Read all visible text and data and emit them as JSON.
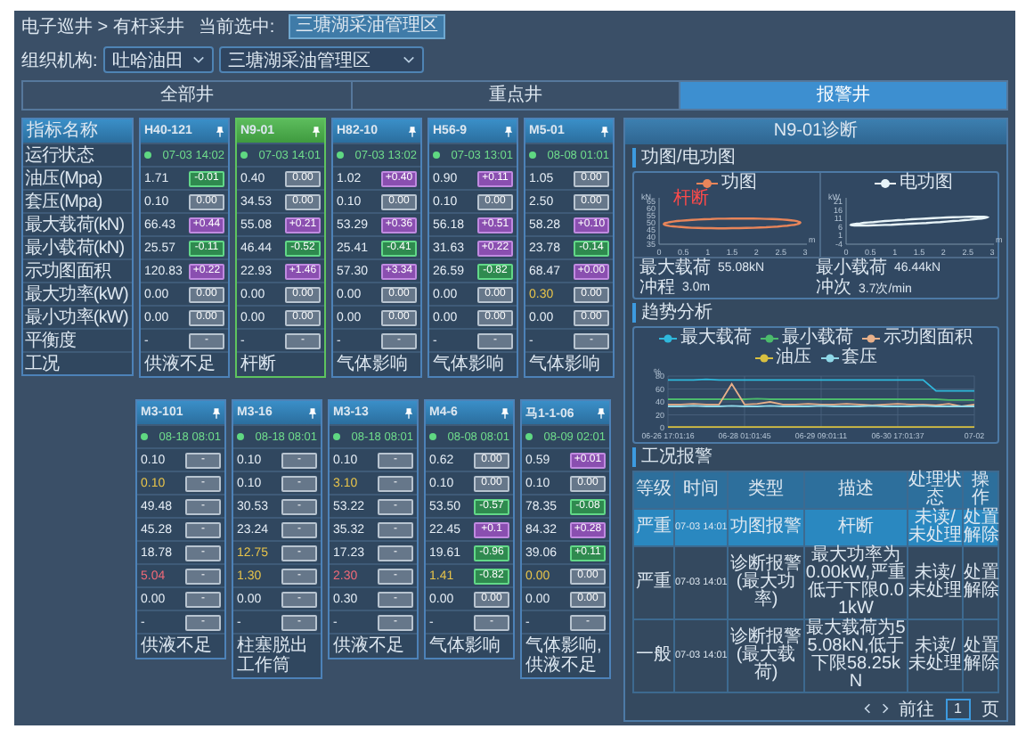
{
  "breadcrumb": {
    "path": "电子巡井 > 有杆采井",
    "current_label": "当前选中:",
    "current_value": "三塘湖采油管理区"
  },
  "filters": {
    "label": "组织机构:",
    "org": "吐哈油田",
    "unit": "三塘湖采油管理区"
  },
  "tabs": [
    {
      "label": "全部井",
      "selected": false
    },
    {
      "label": "重点井",
      "selected": false
    },
    {
      "label": "报警井",
      "selected": true
    }
  ],
  "indicator_header": "指标名称",
  "indicators": [
    "运行状态",
    "油压(Mpa)",
    "套压(Mpa)",
    "最大载荷(kN)",
    "最小载荷(kN)",
    "示功图面积",
    "最大功率(kW)",
    "最小功率(kW)",
    "平衡度",
    "工况"
  ],
  "well_rows": [
    {
      "wells": [
        {
          "name": "H40-121",
          "selected": false,
          "time": "07-03 14:02",
          "values": [
            {
              "value": "1.71",
              "warning": false,
              "alarm": false,
              "delta": "-0.01",
              "up": false,
              "down": true
            },
            {
              "value": "0.10",
              "warning": false,
              "alarm": false,
              "delta": "0.00",
              "up": false,
              "down": false
            },
            {
              "value": "66.43",
              "warning": false,
              "alarm": false,
              "delta": "+0.44",
              "up": true,
              "down": false
            },
            {
              "value": "25.57",
              "warning": false,
              "alarm": false,
              "delta": "-0.11",
              "up": false,
              "down": true
            },
            {
              "value": "120.83",
              "warning": false,
              "alarm": false,
              "delta": "+0.22",
              "up": true,
              "down": false
            },
            {
              "value": "0.00",
              "warning": false,
              "alarm": false,
              "delta": "0.00",
              "up": false,
              "down": false
            },
            {
              "value": "0.00",
              "warning": false,
              "alarm": false,
              "delta": "0.00",
              "up": false,
              "down": false
            },
            {
              "value": "-",
              "warning": false,
              "alarm": false,
              "delta": "-",
              "up": false,
              "down": false
            }
          ],
          "condition": "供液不足"
        },
        {
          "name": "N9-01",
          "selected": true,
          "time": "07-03 14:01",
          "values": [
            {
              "value": "0.40",
              "warning": false,
              "alarm": false,
              "delta": "0.00",
              "up": false,
              "down": false
            },
            {
              "value": "34.53",
              "warning": false,
              "alarm": false,
              "delta": "0.00",
              "up": false,
              "down": false
            },
            {
              "value": "55.08",
              "warning": false,
              "alarm": false,
              "delta": "+0.21",
              "up": true,
              "down": false
            },
            {
              "value": "46.44",
              "warning": false,
              "alarm": false,
              "delta": "-0.52",
              "up": false,
              "down": true
            },
            {
              "value": "22.93",
              "warning": false,
              "alarm": false,
              "delta": "+1.46",
              "up": true,
              "down": false
            },
            {
              "value": "0.00",
              "warning": false,
              "alarm": false,
              "delta": "0.00",
              "up": false,
              "down": false
            },
            {
              "value": "0.00",
              "warning": false,
              "alarm": false,
              "delta": "0.00",
              "up": false,
              "down": false
            },
            {
              "value": "-",
              "warning": false,
              "alarm": false,
              "delta": "-",
              "up": false,
              "down": false
            }
          ],
          "condition": "杆断"
        },
        {
          "name": "H82-10",
          "selected": false,
          "time": "07-03 13:02",
          "values": [
            {
              "value": "1.02",
              "warning": false,
              "alarm": false,
              "delta": "+0.40",
              "up": true,
              "down": false
            },
            {
              "value": "0.10",
              "warning": false,
              "alarm": false,
              "delta": "0.00",
              "up": false,
              "down": false
            },
            {
              "value": "53.29",
              "warning": false,
              "alarm": false,
              "delta": "+0.36",
              "up": true,
              "down": false
            },
            {
              "value": "25.41",
              "warning": false,
              "alarm": false,
              "delta": "-0.41",
              "up": false,
              "down": true
            },
            {
              "value": "57.30",
              "warning": false,
              "alarm": false,
              "delta": "+3.34",
              "up": true,
              "down": false
            },
            {
              "value": "0.00",
              "warning": false,
              "alarm": false,
              "delta": "0.00",
              "up": false,
              "down": false
            },
            {
              "value": "0.00",
              "warning": false,
              "alarm": false,
              "delta": "0.00",
              "up": false,
              "down": false
            },
            {
              "value": "-",
              "warning": false,
              "alarm": false,
              "delta": "-",
              "up": false,
              "down": false
            }
          ],
          "condition": "气体影响"
        },
        {
          "name": "H56-9",
          "selected": false,
          "time": "07-03 13:01",
          "values": [
            {
              "value": "0.90",
              "warning": false,
              "alarm": false,
              "delta": "+0.11",
              "up": true,
              "down": false
            },
            {
              "value": "0.10",
              "warning": false,
              "alarm": false,
              "delta": "0.00",
              "up": false,
              "down": false
            },
            {
              "value": "56.18",
              "warning": false,
              "alarm": false,
              "delta": "+0.51",
              "up": true,
              "down": false
            },
            {
              "value": "31.63",
              "warning": false,
              "alarm": false,
              "delta": "+0.22",
              "up": true,
              "down": false
            },
            {
              "value": "26.59",
              "warning": false,
              "alarm": false,
              "delta": "-0.82",
              "up": false,
              "down": true
            },
            {
              "value": "0.00",
              "warning": false,
              "alarm": false,
              "delta": "0.00",
              "up": false,
              "down": false
            },
            {
              "value": "0.00",
              "warning": false,
              "alarm": false,
              "delta": "0.00",
              "up": false,
              "down": false
            },
            {
              "value": "-",
              "warning": false,
              "alarm": false,
              "delta": "-",
              "up": false,
              "down": false
            }
          ],
          "condition": "气体影响"
        },
        {
          "name": "M5-01",
          "selected": false,
          "time": "08-08 01:01",
          "values": [
            {
              "value": "1.05",
              "warning": false,
              "alarm": false,
              "delta": "0.00",
              "up": false,
              "down": false
            },
            {
              "value": "2.50",
              "warning": false,
              "alarm": false,
              "delta": "0.00",
              "up": false,
              "down": false
            },
            {
              "value": "58.28",
              "warning": false,
              "alarm": false,
              "delta": "+0.10",
              "up": true,
              "down": false
            },
            {
              "value": "23.78",
              "warning": false,
              "alarm": false,
              "delta": "-0.14",
              "up": false,
              "down": true
            },
            {
              "value": "68.47",
              "warning": false,
              "alarm": false,
              "delta": "+0.00",
              "up": true,
              "down": false
            },
            {
              "value": "0.30",
              "warning": true,
              "alarm": false,
              "delta": "0.00",
              "up": false,
              "down": false
            },
            {
              "value": "0.00",
              "warning": false,
              "alarm": false,
              "delta": "0.00",
              "up": false,
              "down": false
            },
            {
              "value": "-",
              "warning": false,
              "alarm": false,
              "delta": "-",
              "up": false,
              "down": false
            }
          ],
          "condition": "气体影响"
        }
      ]
    },
    {
      "wells": [
        {
          "name": "M3-101",
          "selected": false,
          "time": "08-18 08:01",
          "values": [
            {
              "value": "0.10",
              "warning": false,
              "alarm": false,
              "delta": "-",
              "up": false,
              "down": false
            },
            {
              "value": "0.10",
              "warning": true,
              "alarm": false,
              "delta": "-",
              "up": false,
              "down": false
            },
            {
              "value": "49.48",
              "warning": false,
              "alarm": false,
              "delta": "-",
              "up": false,
              "down": false
            },
            {
              "value": "45.28",
              "warning": false,
              "alarm": false,
              "delta": "-",
              "up": false,
              "down": false
            },
            {
              "value": "18.78",
              "warning": false,
              "alarm": false,
              "delta": "-",
              "up": false,
              "down": false
            },
            {
              "value": "5.04",
              "warning": false,
              "alarm": true,
              "delta": "-",
              "up": false,
              "down": false
            },
            {
              "value": "0.00",
              "warning": false,
              "alarm": false,
              "delta": "-",
              "up": false,
              "down": false
            },
            {
              "value": "-",
              "warning": false,
              "alarm": false,
              "delta": "-",
              "up": false,
              "down": false
            }
          ],
          "condition": "供液不足"
        },
        {
          "name": "M3-16",
          "selected": false,
          "time": "08-18 08:01",
          "values": [
            {
              "value": "0.10",
              "warning": false,
              "alarm": false,
              "delta": "-",
              "up": false,
              "down": false
            },
            {
              "value": "0.10",
              "warning": false,
              "alarm": false,
              "delta": "-",
              "up": false,
              "down": false
            },
            {
              "value": "30.53",
              "warning": false,
              "alarm": false,
              "delta": "-",
              "up": false,
              "down": false
            },
            {
              "value": "23.24",
              "warning": false,
              "alarm": false,
              "delta": "-",
              "up": false,
              "down": false
            },
            {
              "value": "12.75",
              "warning": true,
              "alarm": false,
              "delta": "-",
              "up": false,
              "down": false
            },
            {
              "value": "1.30",
              "warning": true,
              "alarm": false,
              "delta": "-",
              "up": false,
              "down": false
            },
            {
              "value": "0.00",
              "warning": false,
              "alarm": false,
              "delta": "-",
              "up": false,
              "down": false
            },
            {
              "value": "-",
              "warning": false,
              "alarm": false,
              "delta": "-",
              "up": false,
              "down": false
            }
          ],
          "condition": "柱塞脱出工作筒"
        },
        {
          "name": "M3-13",
          "selected": false,
          "time": "08-18 08:01",
          "values": [
            {
              "value": "0.10",
              "warning": false,
              "alarm": false,
              "delta": "-",
              "up": false,
              "down": false
            },
            {
              "value": "3.10",
              "warning": true,
              "alarm": false,
              "delta": "-",
              "up": false,
              "down": false
            },
            {
              "value": "53.22",
              "warning": false,
              "alarm": false,
              "delta": "-",
              "up": false,
              "down": false
            },
            {
              "value": "35.32",
              "warning": false,
              "alarm": false,
              "delta": "-",
              "up": false,
              "down": false
            },
            {
              "value": "17.23",
              "warning": false,
              "alarm": false,
              "delta": "-",
              "up": false,
              "down": false
            },
            {
              "value": "2.30",
              "warning": false,
              "alarm": true,
              "delta": "-",
              "up": false,
              "down": false
            },
            {
              "value": "0.30",
              "warning": false,
              "alarm": false,
              "delta": "-",
              "up": false,
              "down": false
            },
            {
              "value": "-",
              "warning": false,
              "alarm": false,
              "delta": "-",
              "up": false,
              "down": false
            }
          ],
          "condition": "供液不足"
        },
        {
          "name": "M4-6",
          "selected": false,
          "time": "08-08 08:01",
          "values": [
            {
              "value": "0.62",
              "warning": false,
              "alarm": false,
              "delta": "0.00",
              "up": false,
              "down": false
            },
            {
              "value": "0.10",
              "warning": false,
              "alarm": false,
              "delta": "0.00",
              "up": false,
              "down": false
            },
            {
              "value": "53.50",
              "warning": false,
              "alarm": false,
              "delta": "-0.57",
              "up": false,
              "down": true
            },
            {
              "value": "22.45",
              "warning": false,
              "alarm": false,
              "delta": "+0.1",
              "up": true,
              "down": false
            },
            {
              "value": "19.61",
              "warning": false,
              "alarm": false,
              "delta": "-0.96",
              "up": false,
              "down": true
            },
            {
              "value": "1.41",
              "warning": true,
              "alarm": false,
              "delta": "-0.82",
              "up": false,
              "down": true
            },
            {
              "value": "0.00",
              "warning": false,
              "alarm": false,
              "delta": "0.00",
              "up": false,
              "down": false
            },
            {
              "value": "-",
              "warning": false,
              "alarm": false,
              "delta": "-",
              "up": false,
              "down": false
            }
          ],
          "condition": "气体影响"
        },
        {
          "name": "马1-1-06",
          "selected": false,
          "time": "08-09 02:01",
          "values": [
            {
              "value": "0.59",
              "warning": false,
              "alarm": false,
              "delta": "+0.01",
              "up": true,
              "down": false
            },
            {
              "value": "0.10",
              "warning": false,
              "alarm": false,
              "delta": "0.00",
              "up": false,
              "down": false
            },
            {
              "value": "78.35",
              "warning": false,
              "alarm": false,
              "delta": "-0.08",
              "up": false,
              "down": true
            },
            {
              "value": "84.32",
              "warning": false,
              "alarm": false,
              "delta": "+0.28",
              "up": true,
              "down": false
            },
            {
              "value": "39.06",
              "warning": false,
              "alarm": false,
              "delta": "+0.11",
              "up": false,
              "down": true
            },
            {
              "value": "0.00",
              "warning": true,
              "alarm": false,
              "delta": "0.00",
              "up": false,
              "down": false
            },
            {
              "value": "0.00",
              "warning": false,
              "alarm": false,
              "delta": "0.00",
              "up": false,
              "down": false
            },
            {
              "value": "-",
              "warning": false,
              "alarm": false,
              "delta": "-",
              "up": false,
              "down": false
            }
          ],
          "condition": "气体影响, 供液不足"
        }
      ]
    }
  ],
  "detail": {
    "title": "N9-01诊断",
    "card_section": {
      "title": "功图/电功图",
      "charts": [
        {
          "kind": "load",
          "legend": "功图",
          "color": "#e8855a",
          "alert": "杆断",
          "y_unit": "kN",
          "y_ticks": [
            "65",
            "60",
            "55",
            "50",
            "45",
            "40",
            "35"
          ],
          "x_unit": "m",
          "x_ticks": [
            "0",
            "0.5",
            "1",
            "1.5",
            "2",
            "2.5",
            "3"
          ]
        },
        {
          "kind": "power",
          "legend": "电功图",
          "color": "#e8f4f8",
          "y_unit": "kW",
          "y_ticks": [
            "21",
            "16",
            "11",
            "6",
            "1",
            "-4"
          ],
          "x_unit": "m",
          "x_ticks": [
            "0",
            "0.5",
            "1",
            "1.5",
            "2",
            "2.5",
            "3"
          ]
        }
      ],
      "stats": [
        {
          "label": "最大载荷",
          "value": "55.08kN"
        },
        {
          "label": "最小载荷",
          "value": "46.44kN"
        },
        {
          "label": "冲程",
          "value": "3.0m"
        },
        {
          "label": "冲次",
          "value": "3.7次/min"
        }
      ]
    },
    "trend_section": {
      "title": "趋势分析",
      "chart_data": {
        "type": "line",
        "ylabel": "%",
        "grid": true,
        "legend": true,
        "categories": [
          "06-26 17:01:16",
          null,
          null,
          null,
          null,
          null,
          "06-28 01:01:45",
          null,
          null,
          null,
          null,
          null,
          "06-29 09:01:11",
          null,
          null,
          null,
          null,
          null,
          "06-30 17:01:37",
          null,
          null,
          null,
          null,
          null,
          "07-02"
        ],
        "ylim": [
          0,
          80
        ],
        "yticks": [
          0,
          20,
          40,
          60,
          80
        ],
        "series": [
          {
            "name": "最大载荷",
            "color": "#2fb8dc",
            "values": [
              74,
              74,
              74,
              75,
              74,
              74,
              74,
              74,
              74,
              74,
              74,
              74,
              74,
              74,
              74,
              74,
              74,
              74,
              74,
              74,
              74,
              57,
              57,
              57,
              57
            ]
          },
          {
            "name": "最小载荷",
            "color": "#4cbb6c",
            "values": [
              44,
              44,
              44,
              44,
              44,
              44,
              44,
              45,
              44,
              44,
              44,
              44,
              44,
              44,
              44,
              44,
              44,
              44,
              44,
              44,
              44,
              44,
              43,
              43,
              43
            ]
          },
          {
            "name": "示功图面积",
            "color": "#e8b08a",
            "values": [
              36,
              36,
              37,
              36,
              36,
              68,
              36,
              37,
              40,
              36,
              36,
              37,
              36,
              36,
              37,
              36,
              35,
              36,
              37,
              36,
              36,
              35,
              37,
              33,
              36
            ]
          },
          {
            "name": "油压",
            "color": "#d8c040",
            "values": [
              1,
              1,
              1,
              1,
              1,
              1,
              1,
              1,
              1,
              1,
              1,
              1,
              1,
              1,
              1,
              1,
              1,
              1,
              1,
              1,
              1,
              1,
              1,
              1,
              1
            ]
          },
          {
            "name": "套压",
            "color": "#8fd8e8",
            "values": [
              33,
              33,
              34,
              33,
              33,
              34,
              33,
              33,
              34,
              33,
              33,
              33,
              34,
              33,
              33,
              33,
              34,
              33,
              33,
              33,
              34,
              33,
              33,
              33,
              33
            ]
          }
        ]
      }
    },
    "alarm_section": {
      "title": "工况报警",
      "columns": [
        "等级",
        "时间",
        "类型",
        "描述",
        "处理状态",
        "操作"
      ],
      "rows": [
        {
          "level": "严重",
          "time": "07-03 14:01",
          "type": "功图报警",
          "description": "杆断",
          "status": "未读/未处理",
          "actions": [
            "处置",
            "解除"
          ],
          "selected": true
        },
        {
          "level": "严重",
          "time": "07-03 14:01",
          "type": "诊断报警(最大功率)",
          "description": "最大功率为0.00kW,严重低于下限0.01kW",
          "status": "未读/未处理",
          "actions": [
            "处置",
            "解除"
          ],
          "selected": false
        },
        {
          "level": "一般",
          "time": "07-03 14:01",
          "type": "诊断报警(最大载荷)",
          "description": "最大载荷为55.08kN,低于下限58.25kN",
          "status": "未读/未处理",
          "actions": [
            "处置",
            "解除"
          ],
          "selected": false
        }
      ],
      "pagination": {
        "goto": "前往",
        "page": "1",
        "unit": "页"
      }
    }
  }
}
